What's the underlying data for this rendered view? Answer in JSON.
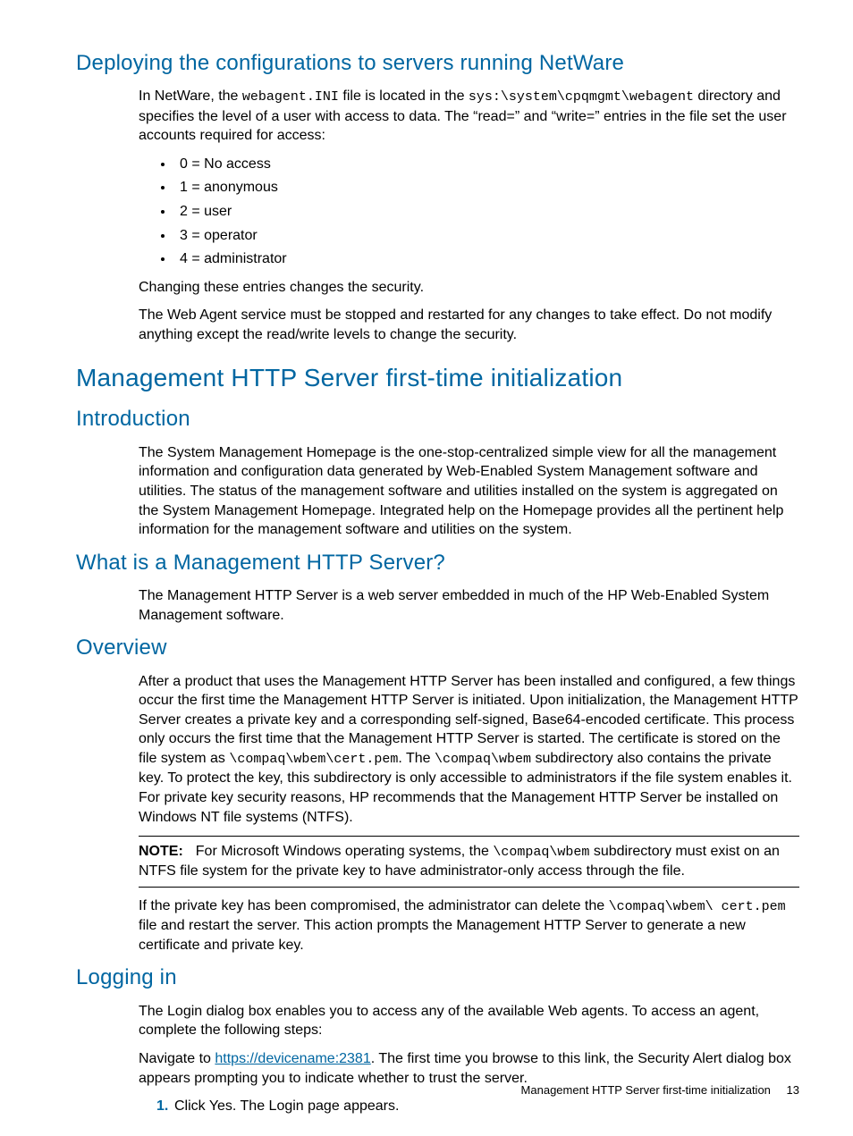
{
  "sec1": {
    "heading": "Deploying the configurations to servers running NetWare",
    "para1a": "In NetWare, the ",
    "code1": "webagent.INI",
    "para1b": " file is located in the ",
    "code2": "sys:\\system\\cpqmgmt\\webagent",
    "para1c": " directory and specifies the level of a user with access to data. The “read=” and “write=” entries in the file set the user accounts required for access:",
    "bullets": [
      "0 = No access",
      "1 = anonymous",
      "2 = user",
      "3 = operator",
      "4 = administrator"
    ],
    "para2": "Changing these entries changes the security.",
    "para3": "The Web Agent service must be stopped and restarted for any changes to take effect. Do not modify anything except the read/write levels to change the security."
  },
  "sec2": {
    "heading": "Management HTTP Server first-time initialization"
  },
  "sec3": {
    "heading": "Introduction",
    "para": "The System Management Homepage is the one-stop-centralized simple view for all the management information and configuration data generated by Web-Enabled System Management software and utilities. The status of the management software and utilities installed on the system is aggregated on the System Management Homepage. Integrated help on the Homepage provides all the pertinent help information for the management software and utilities on the system."
  },
  "sec4": {
    "heading": "What is a Management HTTP Server?",
    "para": "The Management HTTP Server is a web server embedded in much of the HP Web-Enabled System Management software."
  },
  "sec5": {
    "heading": "Overview",
    "para1a": "After a product that uses the Management HTTP Server has been installed and configured, a few things occur the first time the Management HTTP Server is initiated. Upon initialization, the Management HTTP Server creates a private key and a corresponding self-signed, Base64-encoded certificate. This process only occurs the first time that the Management HTTP Server is started. The certificate is stored on the file system as ",
    "code1": "\\compaq\\wbem\\cert.pem",
    "para1b": ". The ",
    "code2": "\\compaq\\wbem",
    "para1c": " subdirectory also contains the private key. To protect the key, this subdirectory is only accessible to administrators if the file system enables it. For private key security reasons, HP recommends that the Management HTTP Server be installed on Windows NT file systems (NTFS).",
    "note_label": "NOTE:",
    "note_a": "For Microsoft Windows operating systems, the ",
    "note_code": "\\compaq\\wbem",
    "note_b": " subdirectory must exist on an NTFS file system for the private key to have administrator-only access through the file.",
    "para2a": "If the private key has been compromised, the administrator can delete the ",
    "code3": "\\compaq\\wbem\\ cert.pem",
    "para2b": " file and restart the server. This action prompts the Management HTTP Server to generate a new certificate and private key."
  },
  "sec6": {
    "heading": "Logging in",
    "para1": "The Login dialog box enables you to access any of the available Web agents. To access an agent, complete the following steps:",
    "para2a": "Navigate to ",
    "url": "https://devicename:2381",
    "para2b": ". The first time you browse to this link, the Security Alert dialog box appears prompting you to indicate whether to trust the server.",
    "step1_num": "1.",
    "step1_text": "Click Yes. The Login page appears."
  },
  "footer": {
    "title": "Management HTTP Server first-time initialization",
    "page": "13"
  }
}
